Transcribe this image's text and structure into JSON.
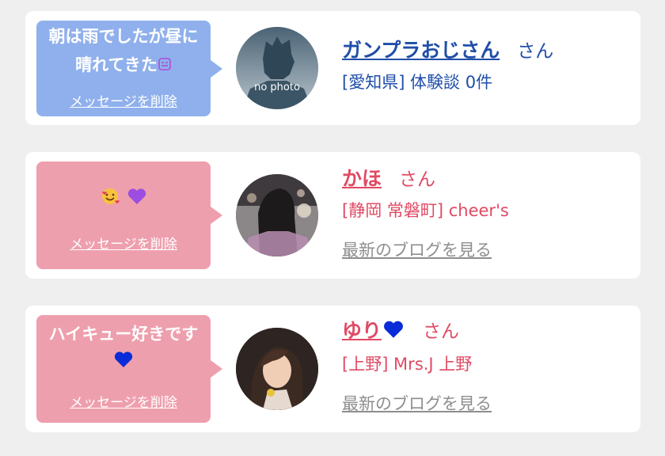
{
  "items": [
    {
      "message": "朝は雨でしたが昼に晴れてきた",
      "delete_label": "メッセージを削除",
      "avatar_text": "no photo",
      "name": "ガンプラおじさん",
      "honorific": "さん",
      "location": "[愛知県] 体験談 0件",
      "color": "#1f4ea8",
      "bubble_color": "#8fb0ec"
    },
    {
      "message": "",
      "emojis": [
        "smiling-face-with-hearts-icon",
        "purple-heart-icon"
      ],
      "delete_label": "メッセージを削除",
      "name": "かほ",
      "honorific": "さん",
      "location": "[静岡 常磐町] cheer's",
      "blog_link": "最新のブログを見る",
      "color": "#e04a64",
      "bubble_color": "#ee9fad"
    },
    {
      "message": "ハイキュー好きです",
      "delete_label": "メッセージを削除",
      "name": "ゆり",
      "honorific": "さん",
      "location": "[上野] Mrs.J 上野",
      "blog_link": "最新のブログを見る",
      "color": "#e04a64",
      "bubble_color": "#ee9fad"
    }
  ]
}
